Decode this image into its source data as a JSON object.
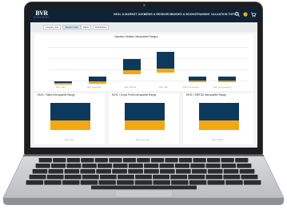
{
  "nav": {
    "logo_mark": "BVR",
    "logo_sub": "BUSINESS VALUATION RESOURCES",
    "items": [
      "DEAL & MARKET DATA",
      "NEWS & RESEARCH",
      "GUIDES & BOOKS",
      "TRAINING",
      "VALUATION TOPICS"
    ],
    "icons": [
      "search-icon",
      "user-icon",
      "cart-icon"
    ]
  },
  "tabs": [
    "Company Info",
    "Valuation Multi",
    "Ratios",
    "Distributions"
  ],
  "main_chart": {
    "title": "Valuation Multiple Interquartile Ranges",
    "categories": [
      "MVIC / Sales",
      "MVIC / Gross Profit",
      "MVIC / EBITDA",
      "MVIC / EBIT",
      "MVIC / Disc. Earnings",
      "MVIC / Disc. Earnings (2)"
    ]
  },
  "small_charts": [
    {
      "title": "MVIC / Sales Interquartile Range",
      "xlabel": "MVIC / Sales"
    },
    {
      "title": "MVIC / Gross Profit Interquartile Range",
      "xlabel": "MVIC / Gross Profit"
    },
    {
      "title": "MVIC / EBITDA Interquartile Range",
      "xlabel": "MVIC / EBITDA"
    }
  ],
  "colors": {
    "navy": "#0d3a5c",
    "orange": "#f3a712",
    "nav_bg": "#0f2233"
  }
}
